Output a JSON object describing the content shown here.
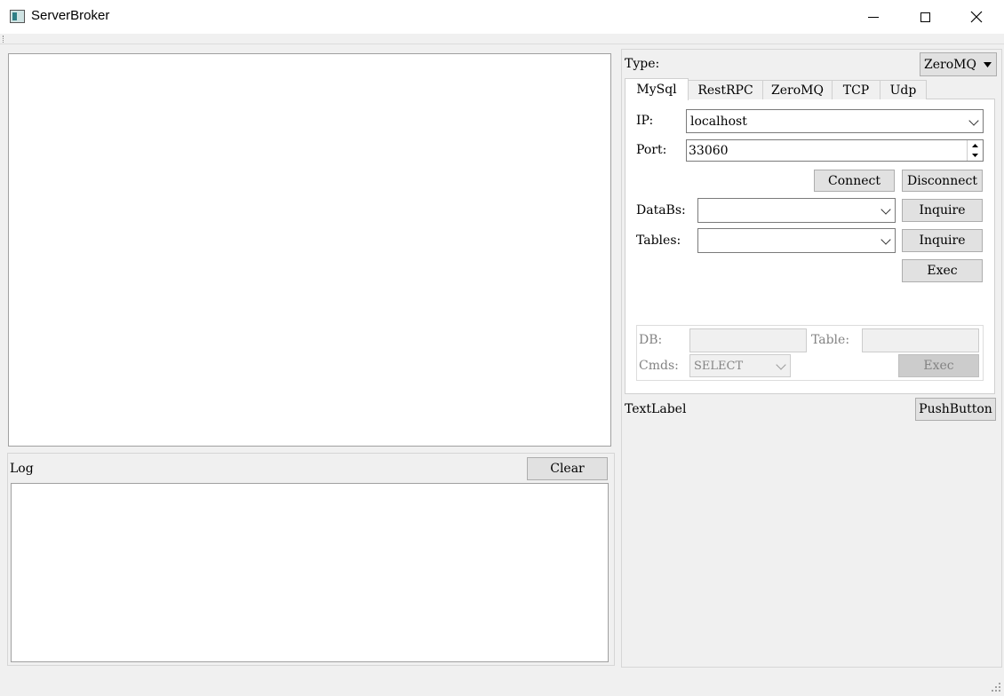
{
  "window": {
    "title": "ServerBroker"
  },
  "log": {
    "label": "Log",
    "clear_label": "Clear"
  },
  "config": {
    "type_label": "Type:",
    "type_value": "ZeroMQ",
    "tabs": [
      {
        "label": "MySql"
      },
      {
        "label": "RestRPC"
      },
      {
        "label": "ZeroMQ"
      },
      {
        "label": "TCP"
      },
      {
        "label": "Udp"
      }
    ],
    "mysql": {
      "ip_label": "IP:",
      "ip_value": "localhost",
      "port_label": "Port:",
      "port_value": "33060",
      "connect_label": "Connect",
      "disconnect_label": "Disconnect",
      "databs_label": "DataBs:",
      "databs_value": "",
      "tables_label": "Tables:",
      "tables_value": "",
      "inquire_label": "Inquire",
      "exec_label": "Exec",
      "group": {
        "db_label": "DB:",
        "table_label": "Table:",
        "cmds_label": "Cmds:",
        "cmds_value": "SELECT",
        "exec_label": "Exec"
      }
    },
    "text_label": "TextLabel",
    "push_button_label": "PushButton"
  },
  "icons": {
    "app": "app-window-icon",
    "minimize": "minimize-icon",
    "maximize": "maximize-icon",
    "close": "close-icon"
  }
}
